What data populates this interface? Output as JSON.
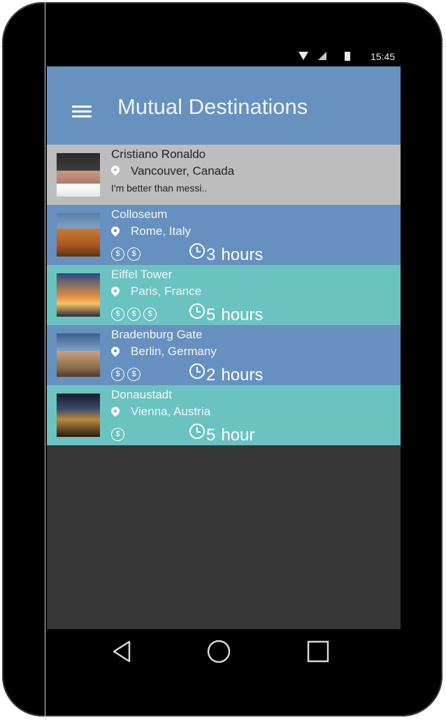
{
  "status_bar": {
    "time": "15:45"
  },
  "app_bar": {
    "title": "Mutual Destinations"
  },
  "profile": {
    "name": "Cristiano Ronaldo",
    "location": "Vancouver, Canada",
    "bio": "I'm better than messi.."
  },
  "destinations": [
    {
      "name": "Colloseum",
      "location": "Rome, Italy",
      "cost_level": 2,
      "time_value": "3",
      "time_unit": "hours"
    },
    {
      "name": "Eiffel Tower",
      "location": "Paris, France",
      "cost_level": 3,
      "time_value": "5",
      "time_unit": "hours"
    },
    {
      "name": "Bradenburg Gate",
      "location": "Berlin, Germany",
      "cost_level": 2,
      "time_value": "2",
      "time_unit": "hours"
    },
    {
      "name": "Donaustadt",
      "location": "Vienna, Austria",
      "cost_level": 1,
      "time_value": "5",
      "time_unit": "hour"
    }
  ],
  "coin_symbol": "$",
  "colors": {
    "app_bar": "#6791bf",
    "row_blue": "#6690bf",
    "row_teal": "#6bc3c1",
    "profile_row": "#bdbdbd",
    "background": "#363636"
  },
  "icons": {
    "menu": "hamburger-menu-icon",
    "location": "map-pin-icon",
    "cost": "dollar-coin-icon",
    "time": "clock-icon",
    "back": "back-triangle-icon",
    "home": "home-circle-icon",
    "recent": "recent-apps-square-icon"
  }
}
